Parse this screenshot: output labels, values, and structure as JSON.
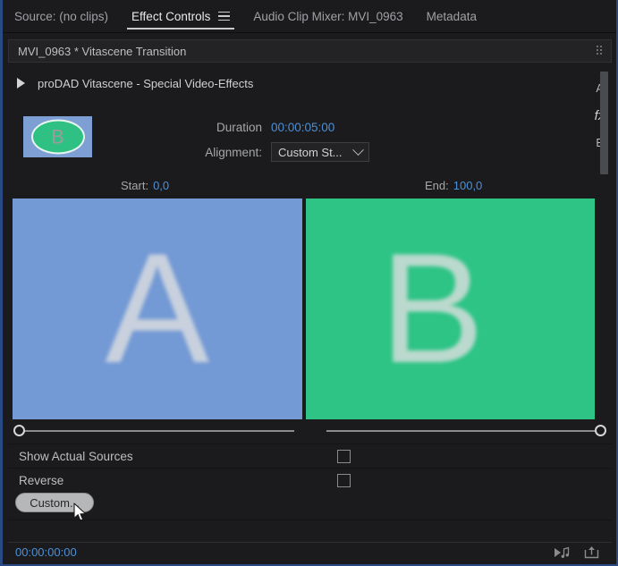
{
  "tabs": [
    {
      "label": "Source: (no clips)",
      "active": false
    },
    {
      "label": "Effect Controls",
      "active": true
    },
    {
      "label": "Audio Clip Mixer: MVI_0963",
      "active": false
    },
    {
      "label": "Metadata",
      "active": false
    }
  ],
  "clip_title": "MVI_0963 * Vitascene Transition",
  "effect": {
    "name": "proDAD Vitascene - Special Video-Effects"
  },
  "rail": {
    "a": "A",
    "fx": "fx",
    "b": "B"
  },
  "thumbnail": {
    "letter": "B"
  },
  "controls": {
    "duration_label": "Duration",
    "duration_value": "00:00:05:00",
    "alignment_label": "Alignment:",
    "alignment_value": "Custom St..."
  },
  "range": {
    "start_label": "Start:",
    "start_value": "0,0",
    "end_label": "End:",
    "end_value": "100,0"
  },
  "preview": {
    "a_letter": "A",
    "b_letter": "B"
  },
  "options": {
    "show_actual_sources": "Show Actual Sources",
    "reverse": "Reverse",
    "custom_button": "Custom..."
  },
  "bottom": {
    "timecode": "00:00:00:00"
  },
  "icons": {
    "panel_menu": "hamburger-menu-icon",
    "disclosure": "disclosure-triangle-icon",
    "dropdown": "chevron-down-icon",
    "play_audio": "play-audio-icon",
    "export_frame": "export-frame-icon",
    "cursor": "mouse-pointer-icon"
  },
  "colors": {
    "panel_bg": "#1b1b1e",
    "accent_blue": "#4b90d8",
    "pane_a": "#739ad5",
    "pane_b": "#2ec486",
    "focus_border": "#2a4a86"
  }
}
